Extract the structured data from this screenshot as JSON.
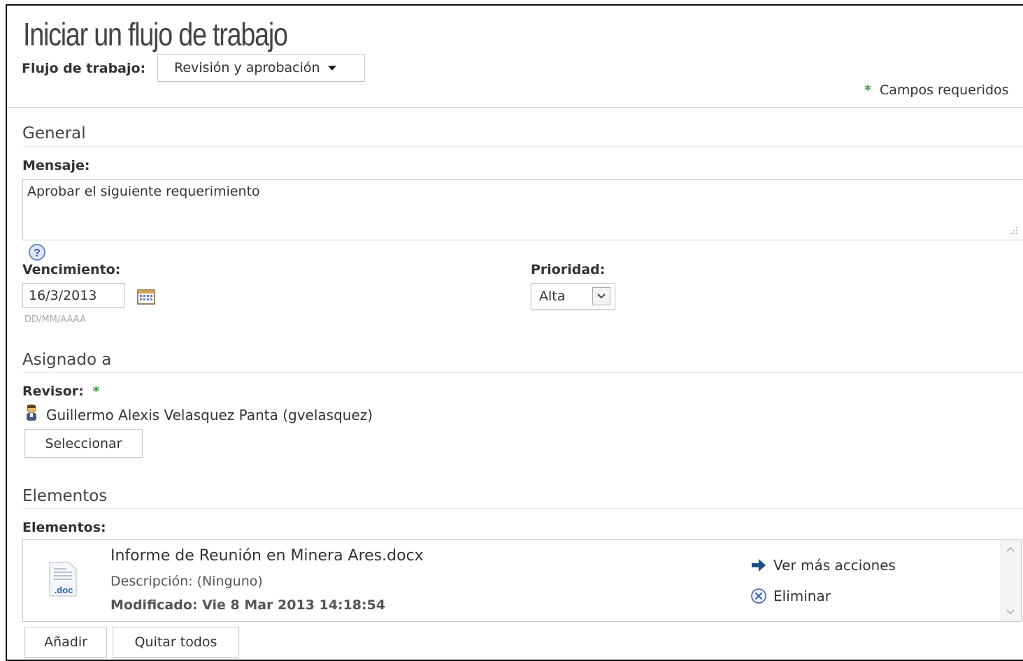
{
  "header": {
    "title": "Iniciar un flujo de trabajo",
    "workflow_label": "Flujo de trabajo:",
    "workflow_value": "Revisión y aprobación",
    "required_star": "*",
    "required_note": "Campos requeridos"
  },
  "general": {
    "section_title": "General",
    "message_label": "Mensaje:",
    "message_value": "Aprobar el siguiente requerimiento",
    "help_glyph": "?",
    "due_label": "Vencimiento:",
    "due_value": "16/3/2013",
    "due_format_hint": "DD/MM/AAAA",
    "priority_label": "Prioridad:",
    "priority_value": "Alta"
  },
  "assigned": {
    "section_title": "Asignado a",
    "reviewer_label": "Revisor:",
    "reviewer_required": "*",
    "reviewer_name": "Guillermo Alexis Velasquez Panta (gvelasquez)",
    "select_button": "Seleccionar"
  },
  "items": {
    "section_title": "Elementos",
    "items_label": "Elementos:",
    "list": [
      {
        "name": "Informe de Reunión en Minera Ares.docx",
        "description": "Descripción: (Ninguno)",
        "modified": "Modificado: Vie 8 Mar 2013 14:18:54",
        "file_badge": ".doc",
        "more_actions": "Ver más acciones",
        "remove": "Eliminar"
      }
    ],
    "add_button": "Añadir",
    "remove_all_button": "Quitar todos"
  },
  "icons": {
    "dropdown": "caret-down-icon",
    "help": "help-icon",
    "calendar": "calendar-icon",
    "select_arrow": "chevron-down-icon",
    "user": "user-icon",
    "file": "doc-file-icon",
    "arrow": "arrow-right-icon",
    "remove": "remove-circle-icon",
    "scroll_up": "chevron-up-icon",
    "scroll_down": "chevron-down-icon"
  },
  "colors": {
    "required": "#3a9a3a",
    "arrow": "#1f4f86",
    "help": "#6a86c8"
  }
}
